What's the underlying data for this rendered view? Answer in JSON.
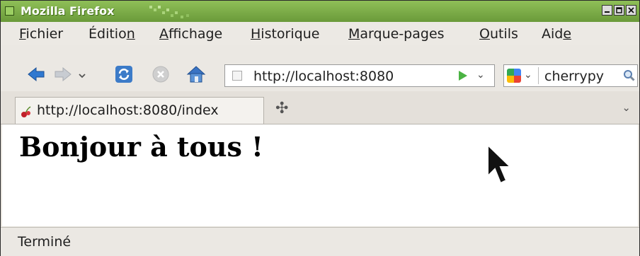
{
  "window": {
    "title": "Mozilla Firefox"
  },
  "menubar": {
    "items": [
      {
        "pre": "",
        "u": "F",
        "post": "ichier"
      },
      {
        "pre": "Éditio",
        "u": "n",
        "post": ""
      },
      {
        "pre": "",
        "u": "A",
        "post": "ffichage"
      },
      {
        "pre": "",
        "u": "H",
        "post": "istorique"
      },
      {
        "pre": "",
        "u": "M",
        "post": "arque-pages"
      },
      {
        "pre": "",
        "u": "O",
        "post": "utils"
      },
      {
        "pre": "Aid",
        "u": "e",
        "post": ""
      }
    ]
  },
  "navbar": {
    "url": "http://localhost:8080",
    "search_text": "cherrypy",
    "icons": [
      "back-icon",
      "forward-icon",
      "history-dropdown-icon",
      "reload-icon",
      "stop-icon",
      "home-icon"
    ]
  },
  "tabs": {
    "items": [
      {
        "label": "http://localhost:8080/index"
      }
    ],
    "new_tab_label": "✣",
    "list_label": "⌄"
  },
  "content": {
    "heading": "Bonjour à tous !"
  },
  "statusbar": {
    "text": "Terminé"
  },
  "colors": {
    "titlebar": "#7aab46",
    "accent_green": "#4bb343",
    "back_blue": "#2f78d0"
  }
}
